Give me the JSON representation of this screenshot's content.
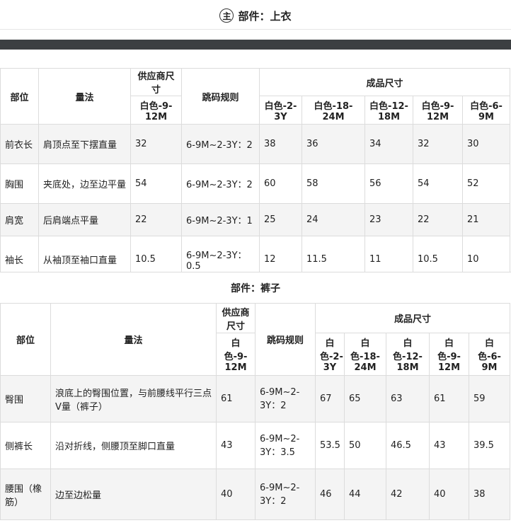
{
  "header": {
    "icon_glyph": "主",
    "title": "部件：上衣"
  },
  "table_top": {
    "head": {
      "part": "部位",
      "method": "量法",
      "supplier": "供应商尺寸",
      "supplier_size": "白色-9-12M",
      "rule": "跳码规则",
      "finished": "成品尺寸",
      "sizes": [
        "白色-2-3Y",
        "白色-18-24M",
        "白色-12-18M",
        "白色-9-12M",
        "白色-6-9M"
      ]
    },
    "rows": [
      {
        "part": "前衣长",
        "method": "肩顶点至下摆直量",
        "supplier": "32",
        "rule": "6-9M~2-3Y：2",
        "values": [
          "38",
          "36",
          "34",
          "32",
          "30"
        ]
      },
      {
        "part": "胸围",
        "method": "夹底处，边至边平量",
        "supplier": "54",
        "rule": "6-9M~2-3Y：2",
        "values": [
          "60",
          "58",
          "56",
          "54",
          "52"
        ]
      },
      {
        "part": "肩宽",
        "method": "后肩端点平量",
        "supplier": "22",
        "rule": "6-9M~2-3Y：1",
        "values": [
          "25",
          "24",
          "23",
          "22",
          "21"
        ]
      },
      {
        "part": "袖长",
        "method": "从袖顶至袖口直量",
        "supplier": "10.5",
        "rule": "6-9M~2-3Y：0.5",
        "values": [
          "12",
          "11.5",
          "11",
          "10.5",
          "10"
        ]
      }
    ]
  },
  "section2": {
    "title": "部件：裤子"
  },
  "table_bottom": {
    "head": {
      "part": "部位",
      "method": "量法",
      "supplier": "供应商尺寸",
      "supplier_size": "白色-9-12M",
      "rule": "跳码规则",
      "finished": "成品尺寸",
      "sizes": [
        "白色-2-3Y",
        "白色-18-24M",
        "白色-12-18M",
        "白色-9-12M",
        "白色-6-9M"
      ]
    },
    "rows": [
      {
        "part": "臀围",
        "method": "浪底上的臀围位置，与前腰线平行三点V量（裤子）",
        "supplier": "61",
        "rule": "6-9M~2-3Y：2",
        "values": [
          "67",
          "65",
          "63",
          "61",
          "59"
        ]
      },
      {
        "part": "侧裤长",
        "method": "沿对折线，侧腰顶至脚口直量",
        "supplier": "43",
        "rule": "6-9M~2-3Y：3.5",
        "values": [
          "53.5",
          "50",
          "46.5",
          "43",
          "39.5"
        ]
      },
      {
        "part": "腰围（橡筋）",
        "method": "边至边松量",
        "supplier": "40",
        "rule": "6-9M~2-3Y：2",
        "values": [
          "46",
          "44",
          "42",
          "40",
          "38"
        ]
      }
    ]
  }
}
